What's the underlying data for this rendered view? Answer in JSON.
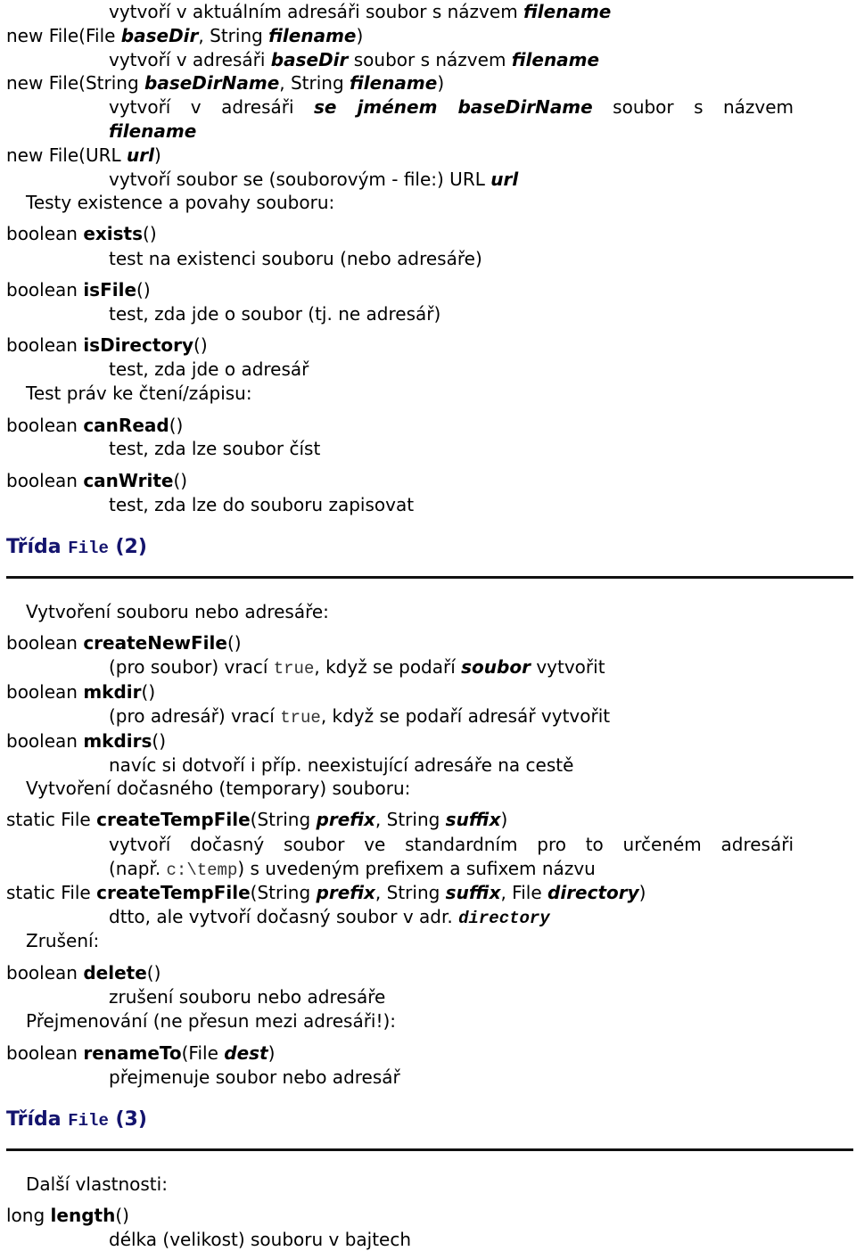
{
  "lines": {
    "l01": "vytvoří v aktuálním adresáři soubor s názvem ",
    "l01b": "filename",
    "l02a": "new File(File ",
    "l02b": "baseDir",
    "l02c": ", String ",
    "l02d": "filename",
    "l02e": ")",
    "l03a": "vytvoří v adresáři ",
    "l03b": "baseDir",
    "l03c": " soubor s názvem ",
    "l03d": "filename",
    "l04a": "new File(String ",
    "l04b": "baseDirName",
    "l04c": ", String ",
    "l04d": "filename",
    "l04e": ")",
    "l05a": "vytvoří v adresáři ",
    "l05b": "se jménem baseDirName",
    "l05c": " soubor s názvem",
    "l06": "filename",
    "l07a": "new File(URL ",
    "l07b": "url",
    "l07c": ")",
    "l08a": "vytvoří soubor se (souborovým - file:) URL ",
    "l08b": "url",
    "h1": "Testy existence a povahy souboru:",
    "m1a": "boolean ",
    "m1b": "exists",
    "m1c": "()",
    "d1": "test na existenci souboru (nebo adresáře)",
    "m2a": "boolean ",
    "m2b": "isFile",
    "m2c": "()",
    "d2": "test, zda jde o soubor (tj. ne adresář)",
    "m3a": "boolean ",
    "m3b": "isDirectory",
    "m3c": "()",
    "d3": "test, zda jde o adresář",
    "h2": "Test práv ke čtení/zápisu:",
    "m4a": "boolean ",
    "m4b": "canRead",
    "m4c": "()",
    "d4": "test, zda lze soubor číst",
    "m5a": "boolean ",
    "m5b": "canWrite",
    "m5c": "()",
    "d5": "test, zda lze do souboru zapisovat"
  },
  "section2": {
    "title_a": "Třída ",
    "title_code": "File",
    "title_b": " (2)",
    "h1": "Vytvoření souboru nebo adresáře:",
    "m1a": "boolean ",
    "m1b": "createNewFile",
    "m1c": "()",
    "d1a": "(pro soubor) vrací ",
    "d1b": "true",
    "d1c": ", když se podaří ",
    "d1d": "soubor",
    "d1e": " vytvořit",
    "m2a": "boolean ",
    "m2b": "mkdir",
    "m2c": "()",
    "d2a": "(pro adresář) vrací ",
    "d2b": "true",
    "d2c": ", když se podaří adresář vytvořit",
    "m3a": "boolean ",
    "m3b": "mkdirs",
    "m3c": "()",
    "d3": "navíc si dotvoří i příp. neexistující adresáře na cestě",
    "h2": "Vytvoření dočasného (temporary) souboru:",
    "m4a": "static File ",
    "m4b": "createTempFile",
    "m4c": "(String ",
    "m4d": "prefix",
    "m4e": ", String ",
    "m4f": "suffix",
    "m4g": ")",
    "d4a": "vytvoří dočasný soubor ve standardním pro to určeném adresáři",
    "d4b1": "(např. ",
    "d4b2": "c:\\temp",
    "d4b3": ") s uvedeným prefixem a sufixem názvu",
    "m5a": "static File ",
    "m5b": "createTempFile",
    "m5c": "(String ",
    "m5d": "prefix",
    "m5e": ", String ",
    "m5f": "suffix",
    "m5g": ", File ",
    "m5h": "directory",
    "m5i": ")",
    "d5a": "dtto, ale vytvoří dočasný soubor v adr. ",
    "d5b": "directory",
    "h3": "Zrušení:",
    "m6a": "boolean ",
    "m6b": "delete",
    "m6c": "()",
    "d6": "zrušení souboru nebo adresáře",
    "h4": "Přejmenování (ne přesun mezi adresáři!):",
    "m7a": "boolean ",
    "m7b": "renameTo",
    "m7c": "(File ",
    "m7d": "dest",
    "m7e": ")",
    "d7": "přejmenuje soubor nebo adresář"
  },
  "section3": {
    "title_a": "Třída ",
    "title_code": "File",
    "title_b": " (3)",
    "h1": "Další vlastnosti:",
    "m1a": "long ",
    "m1b": "length",
    "m1c": "()",
    "d1": "délka (velikost) souboru v bajtech"
  },
  "colors": {
    "heading": "#14146e",
    "rule": "#111111"
  }
}
